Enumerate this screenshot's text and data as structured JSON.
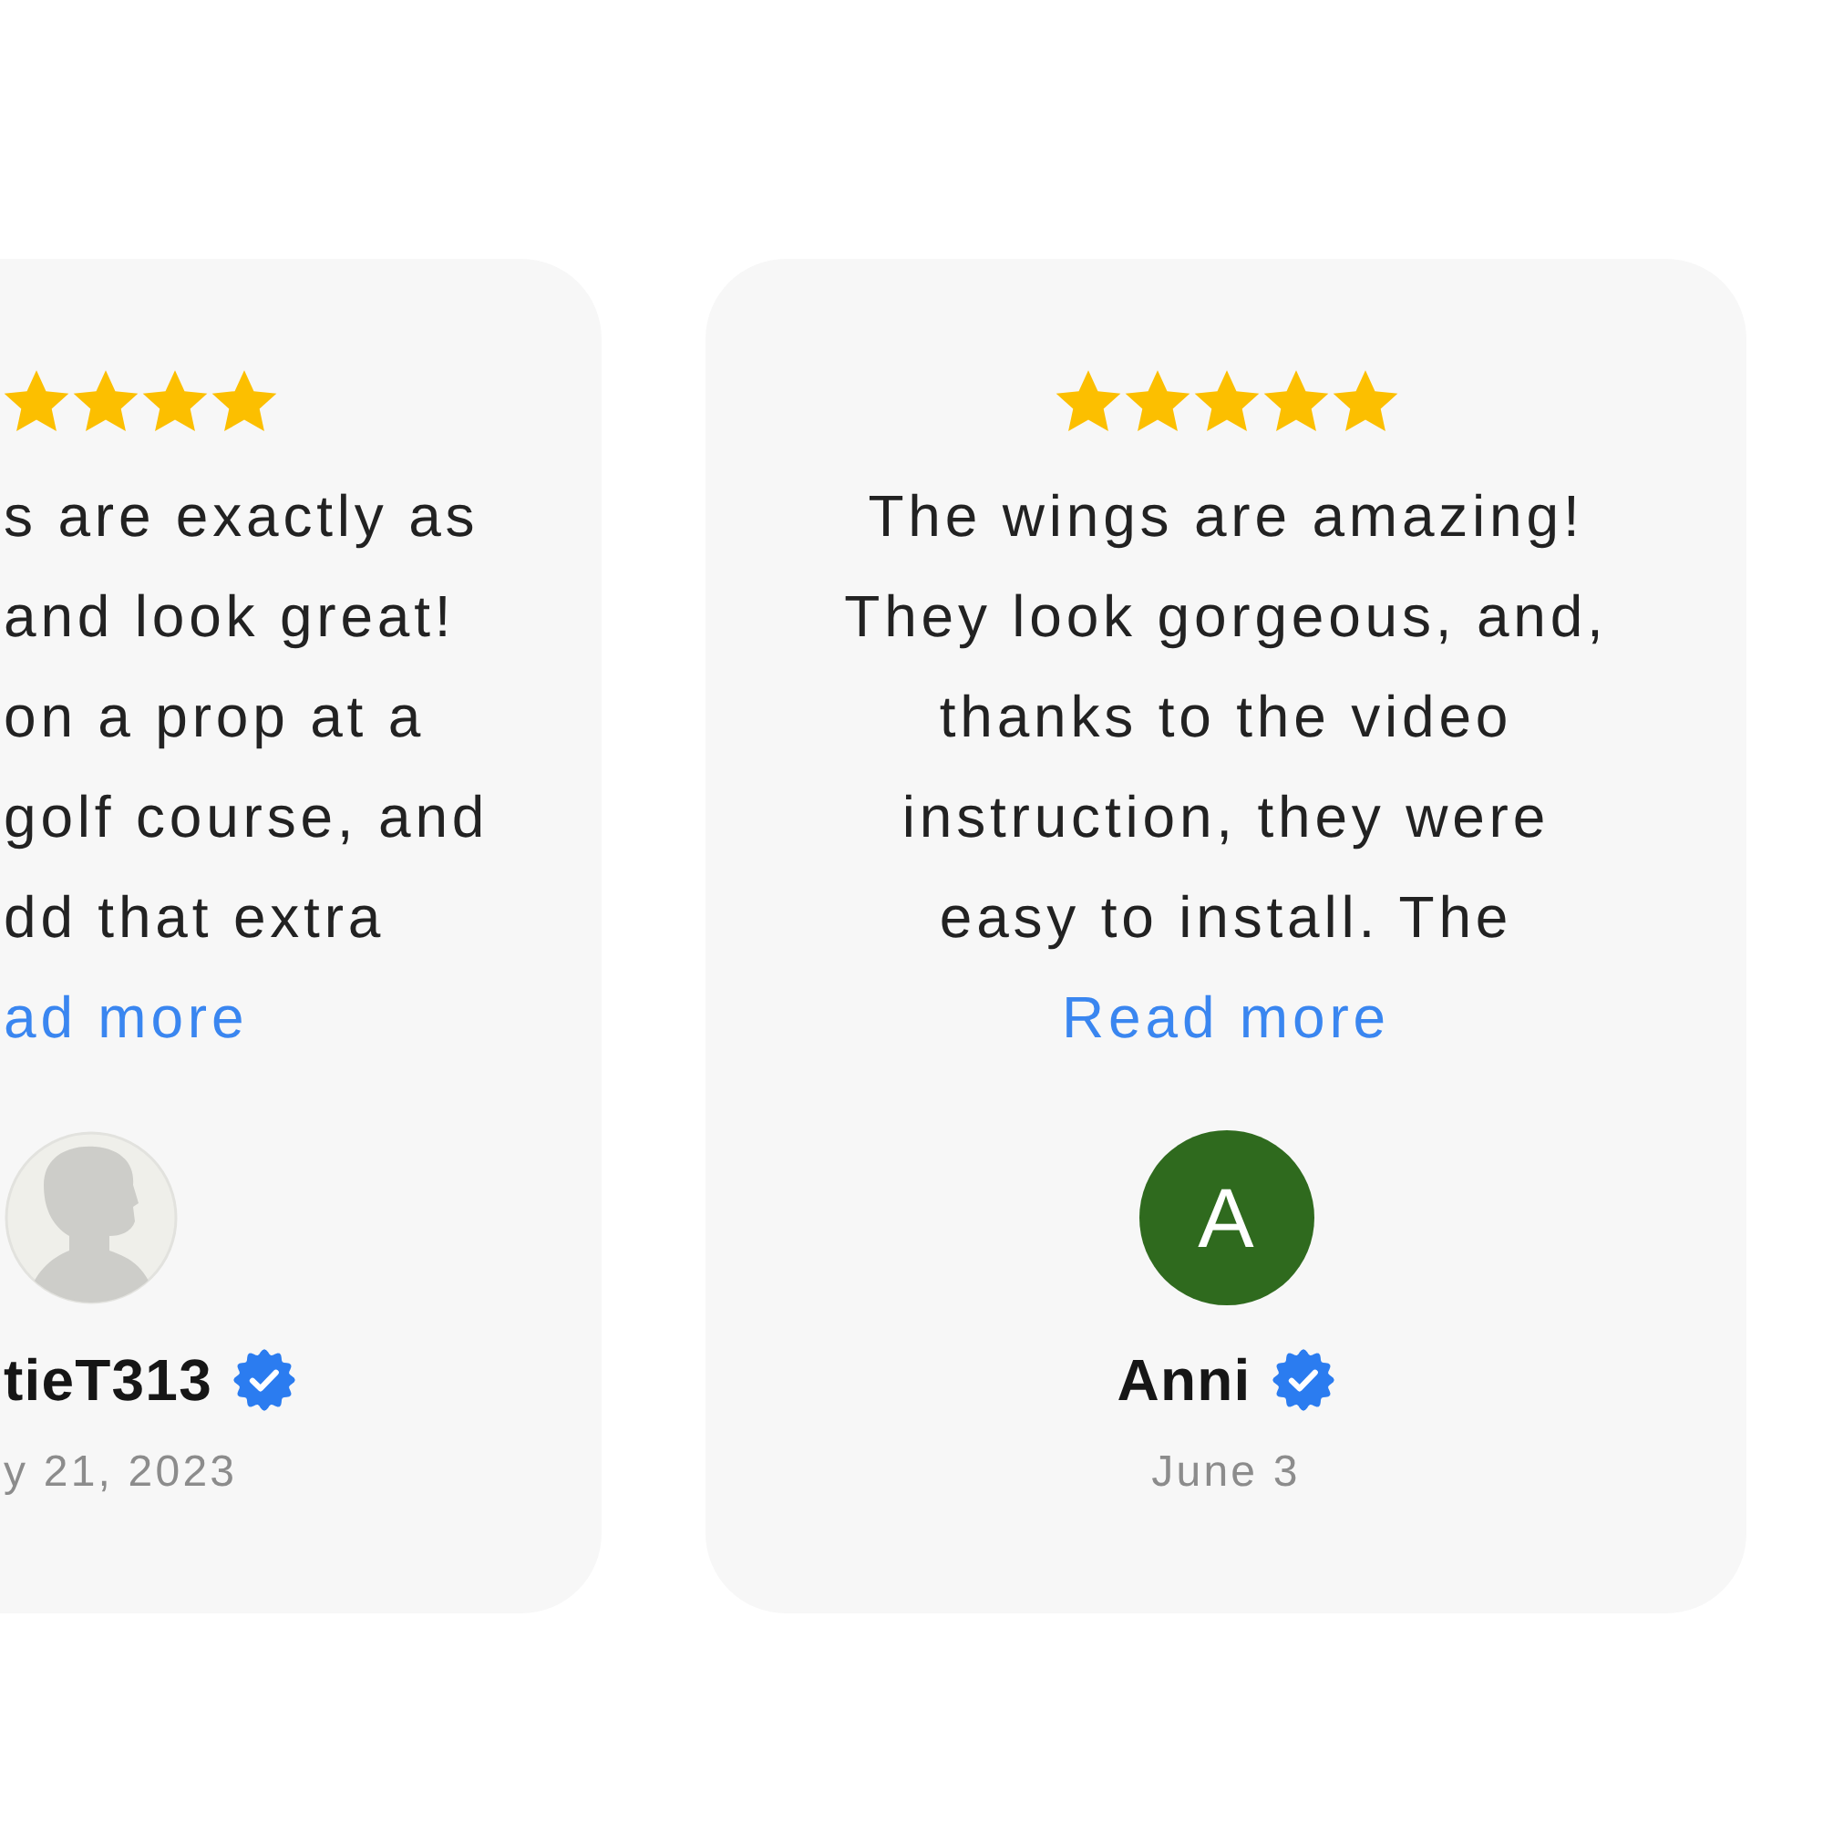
{
  "reviews": [
    {
      "kind": "clipped",
      "stars": 4,
      "review_lines": [
        "s are exactly as",
        "and look great!",
        "on a prop at a",
        "golf course, and",
        "dd that extra"
      ],
      "read_more": "ad more",
      "avatar": {
        "kind": "silhouette"
      },
      "name": "tieT313",
      "verified": true,
      "date": "y 21, 2023"
    },
    {
      "kind": "full",
      "stars": 5,
      "review_lines": [
        "The wings are amazing!",
        "They look gorgeous, and,",
        "thanks to the video",
        "instruction, they were",
        "easy to install. The"
      ],
      "read_more": "Read more",
      "avatar": {
        "kind": "initial",
        "initial": "A"
      },
      "name": "Anni",
      "verified": true,
      "date": "June 3"
    }
  ]
}
